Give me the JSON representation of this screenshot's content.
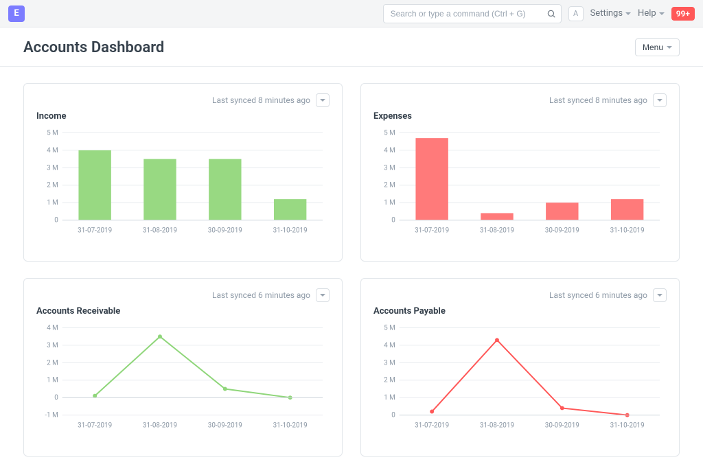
{
  "topbar": {
    "logo_letter": "E",
    "search_placeholder": "Search or type a command (Ctrl + G)",
    "avatar_initial": "A",
    "settings_label": "Settings",
    "help_label": "Help",
    "badge": "99+"
  },
  "header": {
    "title": "Accounts Dashboard",
    "menu_label": "Menu"
  },
  "cards": {
    "income": {
      "title": "Income",
      "synced": "Last synced 8 minutes ago"
    },
    "expenses": {
      "title": "Expenses",
      "synced": "Last synced 8 minutes ago"
    },
    "ar": {
      "title": "Accounts Receivable",
      "synced": "Last synced 6 minutes ago"
    },
    "ap": {
      "title": "Accounts Payable",
      "synced": "Last synced 6 minutes ago"
    }
  },
  "chart_data": [
    {
      "id": "income",
      "type": "bar",
      "title": "Income",
      "categories": [
        "31-07-2019",
        "31-08-2019",
        "30-09-2019",
        "31-10-2019"
      ],
      "values": [
        4000000,
        3500000,
        3500000,
        1200000
      ],
      "y_ticks": [
        "0",
        "1 M",
        "2 M",
        "3 M",
        "4 M",
        "5 M"
      ],
      "ylim": [
        0,
        5000000
      ],
      "color": "#98d982"
    },
    {
      "id": "expenses",
      "type": "bar",
      "title": "Expenses",
      "categories": [
        "31-07-2019",
        "31-08-2019",
        "30-09-2019",
        "31-10-2019"
      ],
      "values": [
        4700000,
        400000,
        1000000,
        1200000
      ],
      "y_ticks": [
        "0",
        "1 M",
        "2 M",
        "3 M",
        "4 M",
        "5 M"
      ],
      "ylim": [
        0,
        5000000
      ],
      "color": "#ff7a7a"
    },
    {
      "id": "ar",
      "type": "line",
      "title": "Accounts Receivable",
      "categories": [
        "31-07-2019",
        "31-08-2019",
        "30-09-2019",
        "31-10-2019"
      ],
      "values": [
        100000,
        3500000,
        500000,
        0
      ],
      "y_ticks": [
        "-1 M",
        "0",
        "1 M",
        "2 M",
        "3 M",
        "4 M"
      ],
      "ylim": [
        -1000000,
        4000000
      ],
      "color": "#8fd67a"
    },
    {
      "id": "ap",
      "type": "line",
      "title": "Accounts Payable",
      "categories": [
        "31-07-2019",
        "31-08-2019",
        "30-09-2019",
        "31-10-2019"
      ],
      "values": [
        200000,
        4300000,
        400000,
        0
      ],
      "y_ticks": [
        "0",
        "1 M",
        "2 M",
        "3 M",
        "4 M",
        "5 M"
      ],
      "ylim": [
        0,
        5000000
      ],
      "color": "#ff5858"
    }
  ]
}
